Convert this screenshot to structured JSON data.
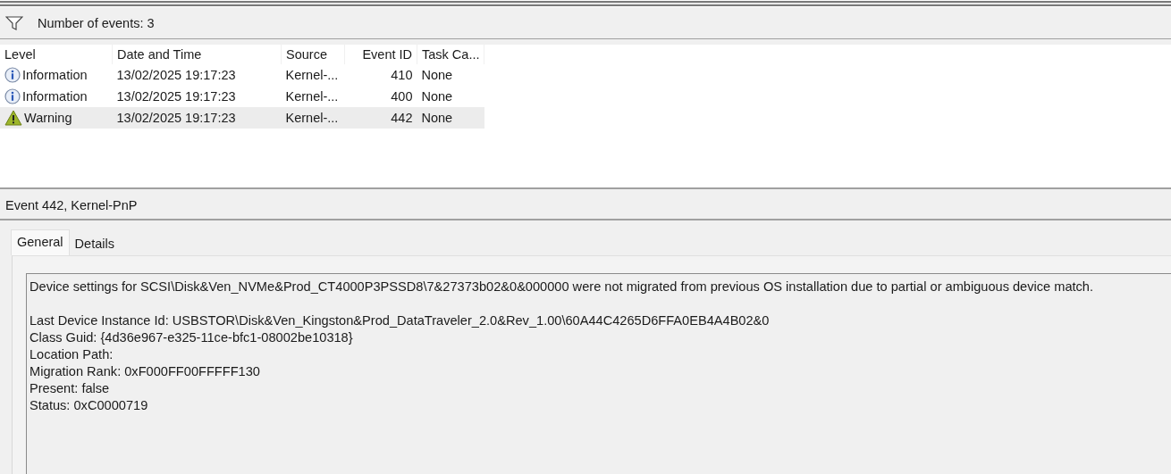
{
  "toolbar": {
    "label": "Number of events: 3"
  },
  "table": {
    "columns": [
      "Level",
      "Date and Time",
      "Source",
      "Event ID",
      "Task Ca..."
    ],
    "rows": [
      {
        "kind": "information",
        "level": "Information",
        "date_time": "13/02/2025 19:17:23",
        "source": "Kernel-...",
        "event_id": "410",
        "task_category": "None",
        "selected": false
      },
      {
        "kind": "information",
        "level": "Information",
        "date_time": "13/02/2025 19:17:23",
        "source": "Kernel-...",
        "event_id": "400",
        "task_category": "None",
        "selected": false
      },
      {
        "kind": "warning",
        "level": "Warning",
        "date_time": "13/02/2025 19:17:23",
        "source": "Kernel-...",
        "event_id": "442",
        "task_category": "None",
        "selected": true
      }
    ]
  },
  "detail": {
    "title": "Event 442, Kernel-PnP",
    "tabs": [
      {
        "label": "General",
        "selected": true
      },
      {
        "label": "Details",
        "selected": false
      }
    ],
    "message": "Device settings for SCSI\\Disk&Ven_NVMe&Prod_CT4000P3PSSD8\\7&27373b02&0&000000 were not migrated from previous OS installation due to partial or ambiguous device match.",
    "properties": [
      "Last Device Instance Id: USBSTOR\\Disk&Ven_Kingston&Prod_DataTraveler_2.0&Rev_1.00\\60A44C4265D6FFA0EB4A4B02&0",
      "Class Guid: {4d36e967-e325-11ce-bfc1-08002be10318}",
      "Location Path:",
      "Migration Rank: 0xF000FF00FFFFF130",
      "Present: false",
      "Status: 0xC0000719"
    ]
  }
}
